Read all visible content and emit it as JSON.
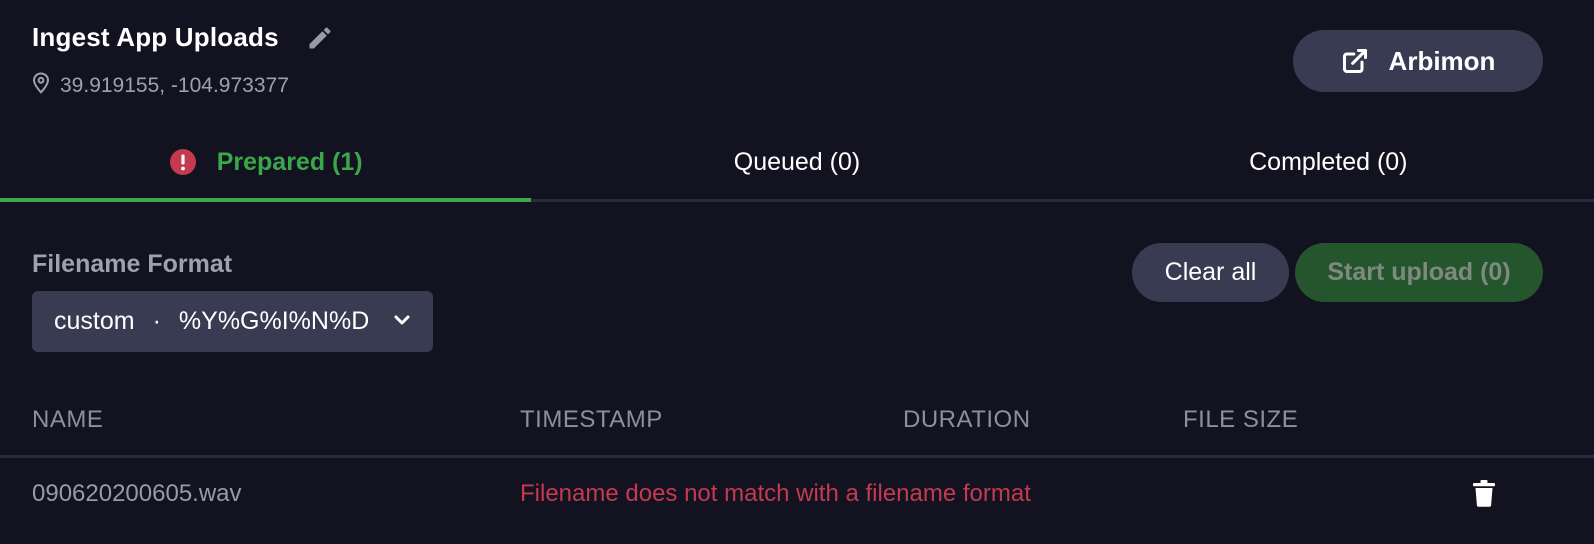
{
  "header": {
    "title": "Ingest App Uploads",
    "coordinates": "39.919155, -104.973377",
    "arbimon_label": "Arbimon"
  },
  "tabs": [
    {
      "label": "Prepared (1)",
      "active": true,
      "icon": "error-icon"
    },
    {
      "label": "Queued (0)",
      "active": false
    },
    {
      "label": "Completed (0)",
      "active": false
    }
  ],
  "filename_format": {
    "label": "Filename Format",
    "selected_type": "custom",
    "separator": "·",
    "selected_pattern": "%Y%G%I%N%D"
  },
  "actions": {
    "clear_label": "Clear all",
    "start_label": "Start upload (0)"
  },
  "table": {
    "columns": [
      "NAME",
      "TIMESTAMP",
      "DURATION",
      "FILE SIZE"
    ],
    "rows": [
      {
        "name": "090620200605.wav",
        "error": "Filename does not match with a filename format"
      }
    ]
  },
  "colors": {
    "background": "#121220",
    "accent_green": "#3aa84a",
    "error_red": "#c43a4e",
    "button_bg": "#383b52"
  }
}
